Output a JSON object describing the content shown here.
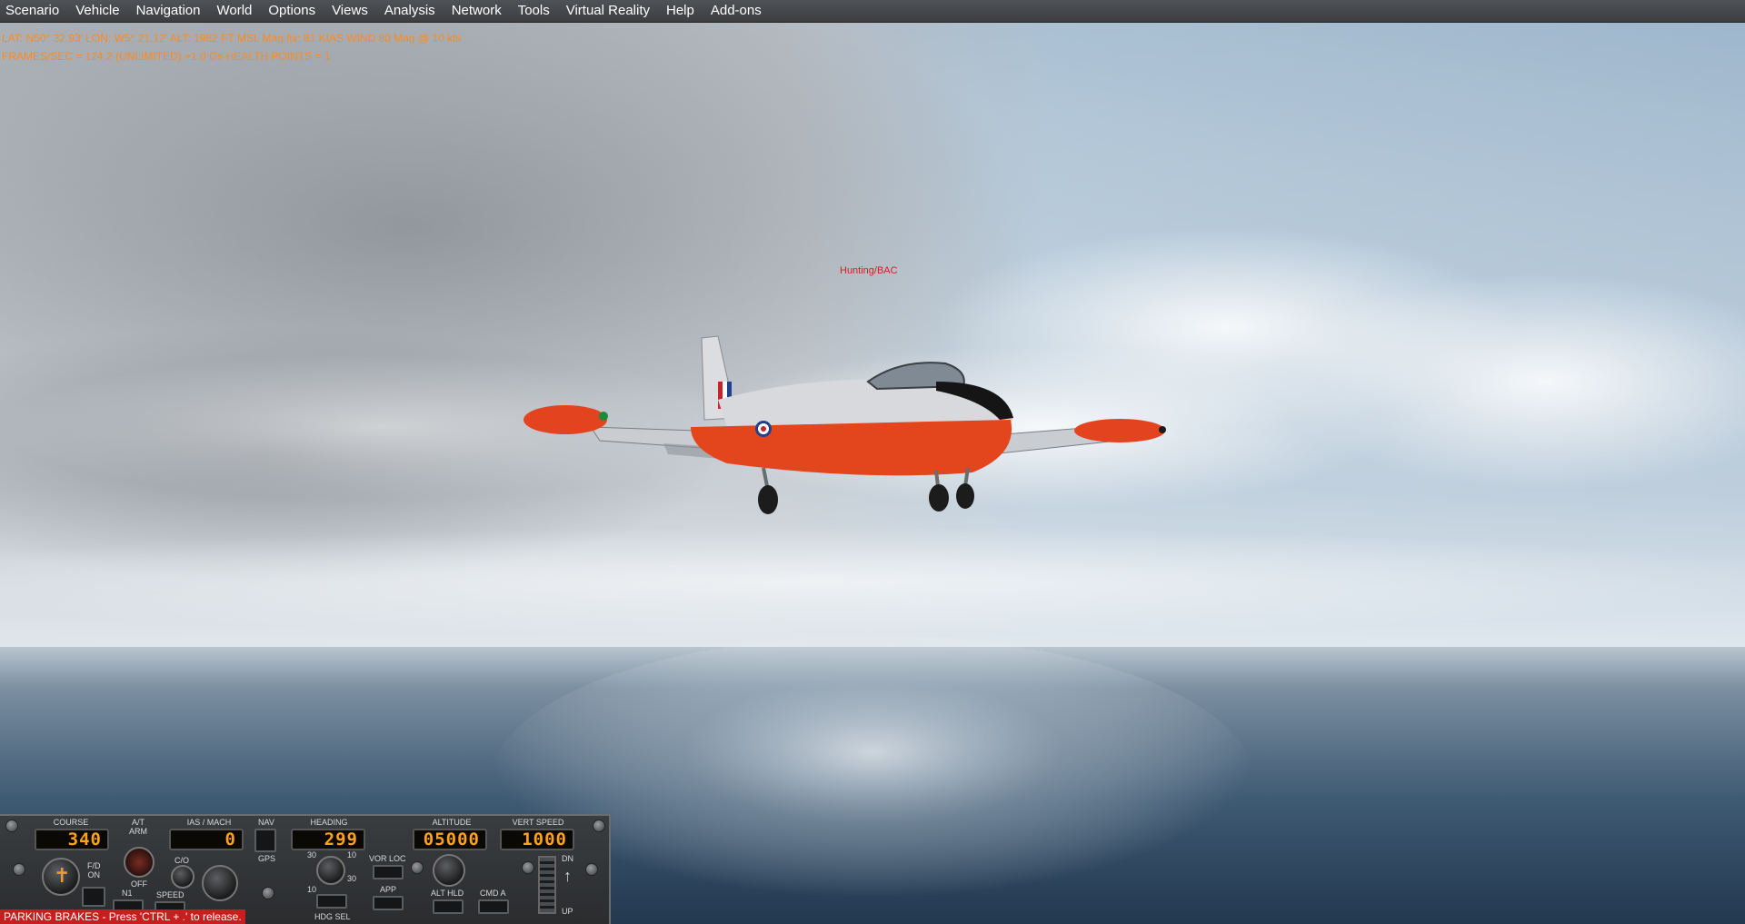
{
  "menu": [
    {
      "label": "Scenario",
      "name": "menu-scenario"
    },
    {
      "label": "Vehicle",
      "name": "menu-vehicle"
    },
    {
      "label": "Navigation",
      "name": "menu-navigation"
    },
    {
      "label": "World",
      "name": "menu-world"
    },
    {
      "label": "Options",
      "name": "menu-options"
    },
    {
      "label": "Views",
      "name": "menu-views"
    },
    {
      "label": "Analysis",
      "name": "menu-analysis"
    },
    {
      "label": "Network",
      "name": "menu-network"
    },
    {
      "label": "Tools",
      "name": "menu-tools"
    },
    {
      "label": "Virtual Reality",
      "name": "menu-virtual-reality"
    },
    {
      "label": "Help",
      "name": "menu-help"
    },
    {
      "label": "Add-ons",
      "name": "menu-add-ons"
    }
  ],
  "info": {
    "position_line": "LAT: N50° 32.93'  LON: W5° 21.12'  ALT: 1982 FT  MSL   Mag fix: 81 KIAS  WIND 80 Mag @ 10 kts",
    "perf_line": "FRAMES/SEC = 124.2   (UNLIMITED)   +1.0 Gs    HEALTH POINTS = 1"
  },
  "aircraft_label": "Hunting/BAC",
  "autopilot": {
    "course": {
      "label": "COURSE",
      "value": "340"
    },
    "at_arm": {
      "label": "A/T\nARM",
      "off_label": "OFF"
    },
    "fd": {
      "label": "F/D\nON"
    },
    "n1": {
      "label": "N1"
    },
    "speed": {
      "label": "SPEED"
    },
    "co": {
      "label": "C/O"
    },
    "ias_mach": {
      "label": "IAS / MACH",
      "value": "0"
    },
    "nav": {
      "label": "NAV",
      "gps_label": "GPS"
    },
    "heading": {
      "label": "HEADING",
      "value": "299",
      "sel_label": "HDG SEL"
    },
    "bank_marks": {
      "t30a": "30",
      "t10a": "10",
      "t10b": "10",
      "t30b": "30"
    },
    "altitude": {
      "label": "ALTITUDE",
      "value": "05000",
      "alt_hld_label": "ALT HLD"
    },
    "vor_loc": {
      "label": "VOR LOC"
    },
    "app": {
      "label": "APP"
    },
    "cmd_a": {
      "label": "CMD A"
    },
    "vert_speed": {
      "label": "VERT SPEED",
      "value": "1000",
      "dn_label": "DN",
      "up_label": "UP"
    }
  },
  "status_message": "PARKING BRAKES - Press 'CTRL + .' to release.",
  "colors": {
    "hud_text": "#ff8a1c",
    "display_digits": "#ffa21a",
    "status_bg": "#c81e1e",
    "aircraft_label": "#d02020"
  }
}
